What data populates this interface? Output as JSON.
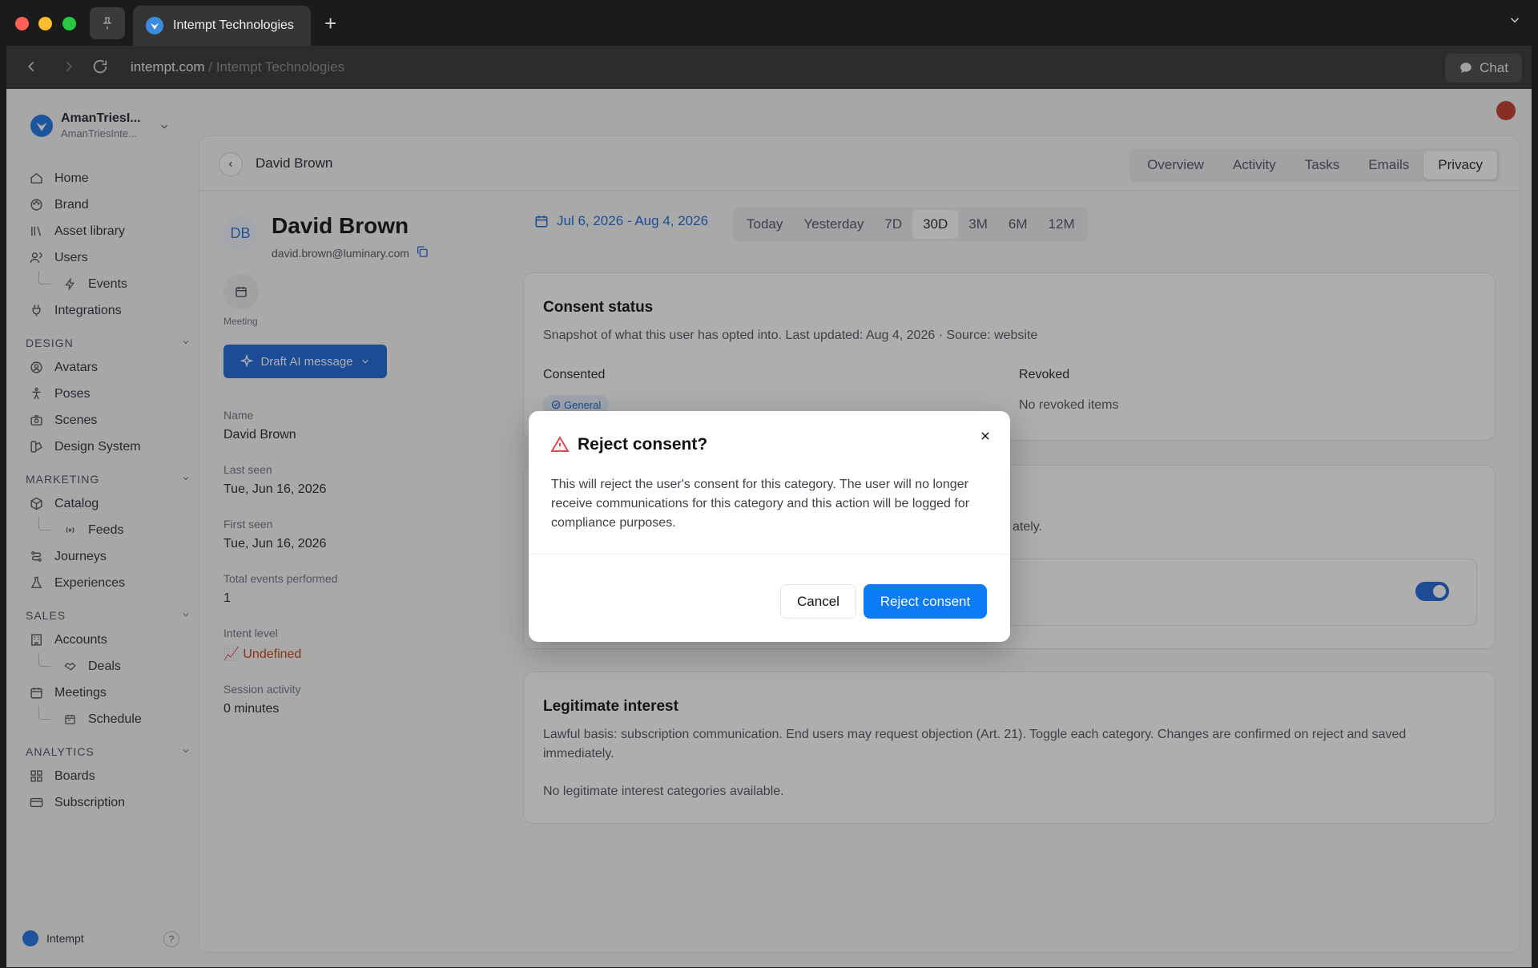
{
  "browser": {
    "tab_title": "Intempt Technologies",
    "new_tab": "+",
    "url_domain": "intempt.com",
    "url_sep": " / ",
    "url_title": "Intempt Technologies",
    "chat_label": "Chat"
  },
  "workspace": {
    "name": "AmanTriesI...",
    "sub": "AmanTriesInte..."
  },
  "sidebar": {
    "items": [
      {
        "label": "Home",
        "icon": "home-icon"
      },
      {
        "label": "Brand",
        "icon": "palette-icon"
      },
      {
        "label": "Asset library",
        "icon": "library-icon"
      },
      {
        "label": "Users",
        "icon": "users-icon"
      },
      {
        "label": "Events",
        "icon": "bolt-icon"
      },
      {
        "label": "Integrations",
        "icon": "plug-icon"
      },
      {
        "label": "Avatars",
        "icon": "avatar-icon"
      },
      {
        "label": "Poses",
        "icon": "pose-icon"
      },
      {
        "label": "Scenes",
        "icon": "camera-icon"
      },
      {
        "label": "Design System",
        "icon": "design-icon"
      },
      {
        "label": "Catalog",
        "icon": "box-icon"
      },
      {
        "label": "Feeds",
        "icon": "broadcast-icon"
      },
      {
        "label": "Journeys",
        "icon": "journey-icon"
      },
      {
        "label": "Experiences",
        "icon": "flask-icon"
      },
      {
        "label": "Accounts",
        "icon": "building-icon"
      },
      {
        "label": "Deals",
        "icon": "handshake-icon"
      },
      {
        "label": "Meetings",
        "icon": "calendar-icon"
      },
      {
        "label": "Schedule",
        "icon": "schedule-icon"
      },
      {
        "label": "Boards",
        "icon": "boards-icon"
      },
      {
        "label": "Subscription",
        "icon": "card-icon"
      }
    ],
    "sections": [
      "DESIGN",
      "MARKETING",
      "SALES",
      "ANALYTICS"
    ],
    "footer_brand": "Intempt",
    "help": "?"
  },
  "header": {
    "breadcrumb": "David Brown",
    "tabs": [
      "Overview",
      "Activity",
      "Tasks",
      "Emails",
      "Privacy"
    ],
    "active_tab": "Privacy"
  },
  "profile": {
    "initials": "DB",
    "name": "David Brown",
    "email": "david.brown@luminary.com",
    "meeting_label": "Meeting",
    "draft_button": "Draft AI message",
    "fields": [
      {
        "label": "Name",
        "value": "David Brown"
      },
      {
        "label": "Last seen",
        "value": "Tue, Jun 16, 2026"
      },
      {
        "label": "First seen",
        "value": "Tue, Jun 16, 2026"
      },
      {
        "label": "Total events performed",
        "value": "1"
      },
      {
        "label": "Intent level",
        "value": "📈 Undefined"
      },
      {
        "label": "Session activity",
        "value": "0 minutes"
      }
    ]
  },
  "date_filter": {
    "range": "Jul 6, 2026 - Aug 4, 2026",
    "options": [
      "Today",
      "Yesterday",
      "7D",
      "30D",
      "3M",
      "6M",
      "12M"
    ],
    "active": "30D"
  },
  "consent": {
    "title": "Consent status",
    "desc": "Snapshot of what this user has opted into. Last updated: Aug 4, 2026 · Source: website",
    "consented_label": "Consented",
    "revoked_label": "Revoked",
    "badge": "General",
    "no_revoked": "No revoked items"
  },
  "card2": {
    "text_fragment": "ately."
  },
  "legit": {
    "title": "Legitimate interest",
    "desc": "Lawful basis: subscription communication. End users may request objection (Art. 21). Toggle each category. Changes are confirmed on reject and saved immediately.",
    "empty": "No legitimate interest categories available."
  },
  "dialog": {
    "title": "Reject consent?",
    "body": "This will reject the user's consent for this category. The user will no longer receive communications for this category and this action will be logged for compliance purposes.",
    "cancel": "Cancel",
    "confirm": "Reject consent",
    "warning_color": "#e5484d",
    "confirm_color": "#0b7cf5"
  }
}
